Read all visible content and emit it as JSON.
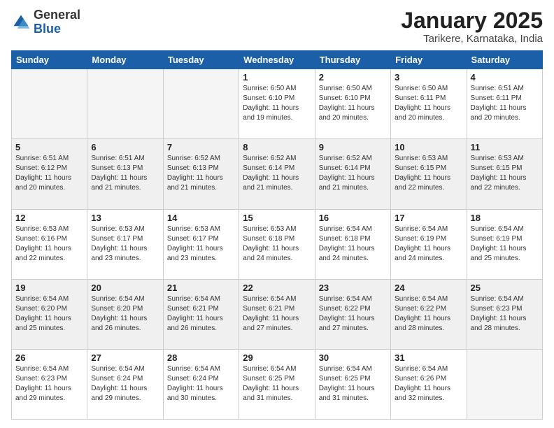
{
  "logo": {
    "general": "General",
    "blue": "Blue"
  },
  "header": {
    "title": "January 2025",
    "subtitle": "Tarikere, Karnataka, India"
  },
  "weekdays": [
    "Sunday",
    "Monday",
    "Tuesday",
    "Wednesday",
    "Thursday",
    "Friday",
    "Saturday"
  ],
  "weeks": [
    [
      {
        "day": "",
        "info": ""
      },
      {
        "day": "",
        "info": ""
      },
      {
        "day": "",
        "info": ""
      },
      {
        "day": "1",
        "info": "Sunrise: 6:50 AM\nSunset: 6:10 PM\nDaylight: 11 hours and 19 minutes."
      },
      {
        "day": "2",
        "info": "Sunrise: 6:50 AM\nSunset: 6:10 PM\nDaylight: 11 hours and 20 minutes."
      },
      {
        "day": "3",
        "info": "Sunrise: 6:50 AM\nSunset: 6:11 PM\nDaylight: 11 hours and 20 minutes."
      },
      {
        "day": "4",
        "info": "Sunrise: 6:51 AM\nSunset: 6:11 PM\nDaylight: 11 hours and 20 minutes."
      }
    ],
    [
      {
        "day": "5",
        "info": "Sunrise: 6:51 AM\nSunset: 6:12 PM\nDaylight: 11 hours and 20 minutes."
      },
      {
        "day": "6",
        "info": "Sunrise: 6:51 AM\nSunset: 6:13 PM\nDaylight: 11 hours and 21 minutes."
      },
      {
        "day": "7",
        "info": "Sunrise: 6:52 AM\nSunset: 6:13 PM\nDaylight: 11 hours and 21 minutes."
      },
      {
        "day": "8",
        "info": "Sunrise: 6:52 AM\nSunset: 6:14 PM\nDaylight: 11 hours and 21 minutes."
      },
      {
        "day": "9",
        "info": "Sunrise: 6:52 AM\nSunset: 6:14 PM\nDaylight: 11 hours and 21 minutes."
      },
      {
        "day": "10",
        "info": "Sunrise: 6:53 AM\nSunset: 6:15 PM\nDaylight: 11 hours and 22 minutes."
      },
      {
        "day": "11",
        "info": "Sunrise: 6:53 AM\nSunset: 6:15 PM\nDaylight: 11 hours and 22 minutes."
      }
    ],
    [
      {
        "day": "12",
        "info": "Sunrise: 6:53 AM\nSunset: 6:16 PM\nDaylight: 11 hours and 22 minutes."
      },
      {
        "day": "13",
        "info": "Sunrise: 6:53 AM\nSunset: 6:17 PM\nDaylight: 11 hours and 23 minutes."
      },
      {
        "day": "14",
        "info": "Sunrise: 6:53 AM\nSunset: 6:17 PM\nDaylight: 11 hours and 23 minutes."
      },
      {
        "day": "15",
        "info": "Sunrise: 6:53 AM\nSunset: 6:18 PM\nDaylight: 11 hours and 24 minutes."
      },
      {
        "day": "16",
        "info": "Sunrise: 6:54 AM\nSunset: 6:18 PM\nDaylight: 11 hours and 24 minutes."
      },
      {
        "day": "17",
        "info": "Sunrise: 6:54 AM\nSunset: 6:19 PM\nDaylight: 11 hours and 24 minutes."
      },
      {
        "day": "18",
        "info": "Sunrise: 6:54 AM\nSunset: 6:19 PM\nDaylight: 11 hours and 25 minutes."
      }
    ],
    [
      {
        "day": "19",
        "info": "Sunrise: 6:54 AM\nSunset: 6:20 PM\nDaylight: 11 hours and 25 minutes."
      },
      {
        "day": "20",
        "info": "Sunrise: 6:54 AM\nSunset: 6:20 PM\nDaylight: 11 hours and 26 minutes."
      },
      {
        "day": "21",
        "info": "Sunrise: 6:54 AM\nSunset: 6:21 PM\nDaylight: 11 hours and 26 minutes."
      },
      {
        "day": "22",
        "info": "Sunrise: 6:54 AM\nSunset: 6:21 PM\nDaylight: 11 hours and 27 minutes."
      },
      {
        "day": "23",
        "info": "Sunrise: 6:54 AM\nSunset: 6:22 PM\nDaylight: 11 hours and 27 minutes."
      },
      {
        "day": "24",
        "info": "Sunrise: 6:54 AM\nSunset: 6:22 PM\nDaylight: 11 hours and 28 minutes."
      },
      {
        "day": "25",
        "info": "Sunrise: 6:54 AM\nSunset: 6:23 PM\nDaylight: 11 hours and 28 minutes."
      }
    ],
    [
      {
        "day": "26",
        "info": "Sunrise: 6:54 AM\nSunset: 6:23 PM\nDaylight: 11 hours and 29 minutes."
      },
      {
        "day": "27",
        "info": "Sunrise: 6:54 AM\nSunset: 6:24 PM\nDaylight: 11 hours and 29 minutes."
      },
      {
        "day": "28",
        "info": "Sunrise: 6:54 AM\nSunset: 6:24 PM\nDaylight: 11 hours and 30 minutes."
      },
      {
        "day": "29",
        "info": "Sunrise: 6:54 AM\nSunset: 6:25 PM\nDaylight: 11 hours and 31 minutes."
      },
      {
        "day": "30",
        "info": "Sunrise: 6:54 AM\nSunset: 6:25 PM\nDaylight: 11 hours and 31 minutes."
      },
      {
        "day": "31",
        "info": "Sunrise: 6:54 AM\nSunset: 6:26 PM\nDaylight: 11 hours and 32 minutes."
      },
      {
        "day": "",
        "info": ""
      }
    ]
  ]
}
